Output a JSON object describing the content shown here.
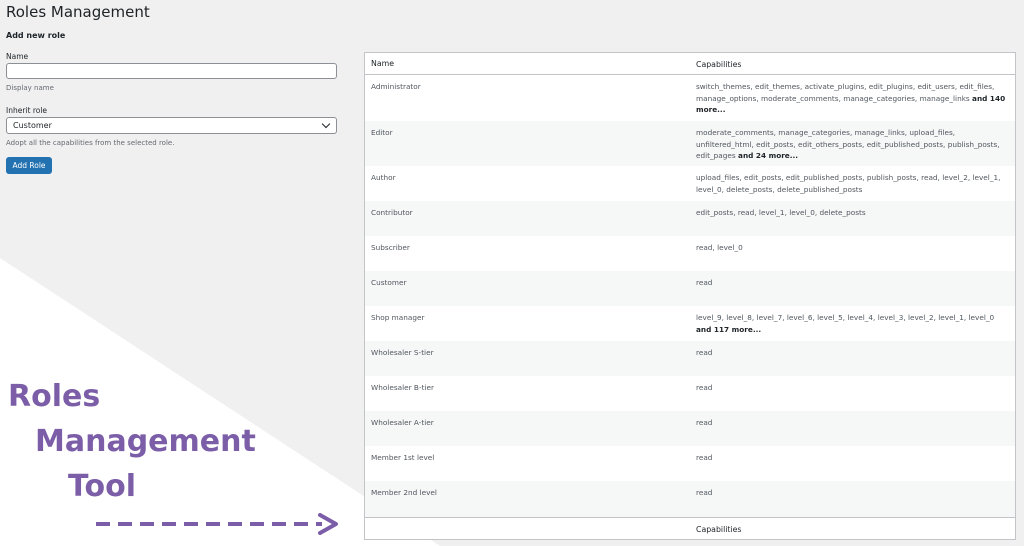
{
  "page": {
    "title": "Roles Management"
  },
  "form": {
    "heading": "Add new role",
    "name_label": "Name",
    "name_value": "",
    "name_description": "Display name",
    "inherit_label": "Inherit role",
    "inherit_selected": "Customer",
    "inherit_description": "Adopt all the capabilities from the selected role.",
    "add_button": "Add Role"
  },
  "table": {
    "header_name": "Name",
    "header_capabilities": "Capabilities",
    "footer_capabilities": "Capabilities",
    "rows": [
      {
        "name": "Administrator",
        "caps": "switch_themes, edit_themes, activate_plugins, edit_plugins, edit_users, edit_files, manage_options, moderate_comments, manage_categories, manage_links",
        "more": "and 140 more..."
      },
      {
        "name": "Editor",
        "caps": "moderate_comments, manage_categories, manage_links, upload_files, unfiltered_html, edit_posts, edit_others_posts, edit_published_posts, publish_posts, edit_pages",
        "more": "and 24 more..."
      },
      {
        "name": "Author",
        "caps": "upload_files, edit_posts, edit_published_posts, publish_posts, read, level_2, level_1, level_0, delete_posts, delete_published_posts",
        "more": ""
      },
      {
        "name": "Contributor",
        "caps": "edit_posts, read, level_1, level_0, delete_posts",
        "more": ""
      },
      {
        "name": "Subscriber",
        "caps": "read, level_0",
        "more": ""
      },
      {
        "name": "Customer",
        "caps": "read",
        "more": ""
      },
      {
        "name": "Shop manager",
        "caps": "level_9, level_8, level_7, level_6, level_5, level_4, level_3, level_2, level_1, level_0",
        "more": "and 117 more..."
      },
      {
        "name": "Wholesaler S-tier",
        "caps": "read",
        "more": ""
      },
      {
        "name": "Wholesaler B-tier",
        "caps": "read",
        "more": ""
      },
      {
        "name": "Wholesaler A-tier",
        "caps": "read",
        "more": ""
      },
      {
        "name": "Member 1st level",
        "caps": "read",
        "more": ""
      },
      {
        "name": "Member 2nd level",
        "caps": "read",
        "more": ""
      }
    ]
  },
  "promo": {
    "line1": "Roles",
    "line2": "Management",
    "line3": "Tool"
  },
  "colors": {
    "accent": "#2271b1",
    "promo": "#7b5ea7"
  }
}
